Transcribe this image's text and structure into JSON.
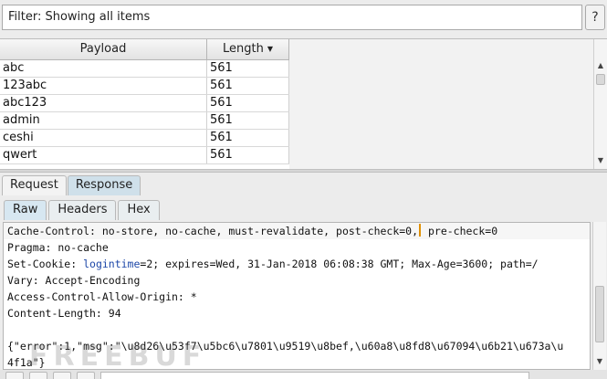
{
  "filter": {
    "text": "Filter: Showing all items"
  },
  "help": {
    "label": "?"
  },
  "table": {
    "columns": {
      "payload": "Payload",
      "length": "Length"
    },
    "rows": [
      {
        "payload": "abc",
        "length": "561"
      },
      {
        "payload": "123abc",
        "length": "561"
      },
      {
        "payload": "abc123",
        "length": "561"
      },
      {
        "payload": "admin",
        "length": "561"
      },
      {
        "payload": "ceshi",
        "length": "561"
      },
      {
        "payload": "qwert",
        "length": "561"
      }
    ]
  },
  "tabs": {
    "request": "Request",
    "response": "Response"
  },
  "subtabs": {
    "raw": "Raw",
    "headers": "Headers",
    "hex": "Hex"
  },
  "editor": {
    "line1a": "Cache-Control: no-store, no-cache, must-revalidate, post-check=0,",
    "line1b": " pre-check=0",
    "line2": "Pragma: no-cache",
    "line3a": "Set-Cookie: ",
    "line3b": "logintime",
    "line3c": "=2; expires=Wed, 31-Jan-2018 06:08:38 GMT; Max-Age=3600; path=/",
    "line4": "Vary: Accept-Encoding",
    "line5": "Access-Control-Allow-Origin: *",
    "line6": "Content-Length: 94",
    "line7": "",
    "line8": "{\"error\":1,\"msg\":\"\\u8d26\\u53f7\\u5bc6\\u7801\\u9519\\u8bef,\\u60a8\\u8fd8\\u67094\\u6b21\\u673a\\u",
    "line9": "4f1a\"}"
  },
  "watermark": "FREEBUF",
  "colors": {
    "accent_tab": "#cfe0ea",
    "keyword": "#1d47a8",
    "caret": "#e09000"
  },
  "icons": {
    "sort": "sort-down-icon",
    "scroll_up": "chevron-up-icon",
    "scroll_down": "chevron-down-icon"
  }
}
